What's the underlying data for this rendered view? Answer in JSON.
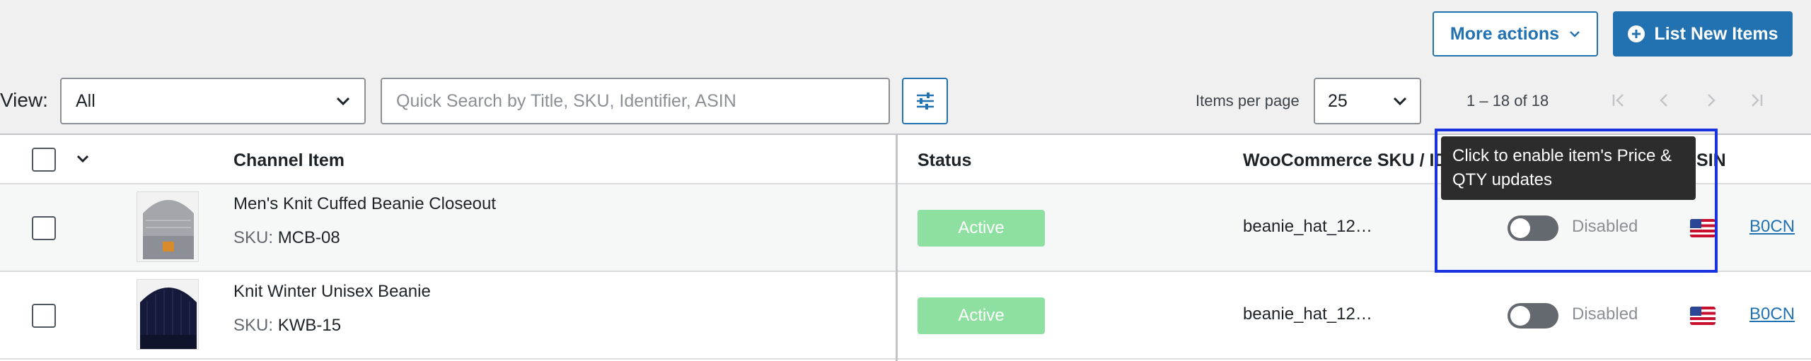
{
  "toolbar": {
    "more_actions_label": "More actions",
    "list_new_items_label": "List New Items",
    "view_label": "View:",
    "view_selected": "All",
    "search_placeholder": "Quick Search by Title, SKU, Identifier, ASIN",
    "items_per_page_label": "Items per page",
    "items_per_page_selected": "25",
    "range_text": "1 – 18 of 18"
  },
  "table": {
    "headers": {
      "channel_item": "Channel Item",
      "status": "Status",
      "woo_sku": "WooCommerce SKU / ID",
      "asin": "ASIN"
    },
    "rows": [
      {
        "title": "Men's Knit Cuffed Beanie Closeout",
        "sku_label": "SKU:",
        "sku": "MCB-08",
        "status": "Active",
        "woo_sku": "beanie_hat_12…",
        "toggle_label": "Disabled",
        "asin": "B0CN"
      },
      {
        "title": "Knit Winter Unisex Beanie",
        "sku_label": "SKU:",
        "sku": "KWB-15",
        "status": "Active",
        "woo_sku": "beanie_hat_12…",
        "toggle_label": "Disabled",
        "asin": "B0CN"
      }
    ]
  },
  "tooltip": {
    "text": "Click to enable item's Price & QTY updates"
  },
  "colors": {
    "primary": "#2271b1",
    "active_badge": "#8ee0a0",
    "highlight": "#1a33e0",
    "tooltip_bg": "#2c2c2c"
  },
  "icons": {
    "more_actions": "chevron-down-icon",
    "list_new_items": "plus-circle-icon",
    "filter": "sliders-icon",
    "pager": [
      "first-page-icon",
      "prev-page-icon",
      "next-page-icon",
      "last-page-icon"
    ],
    "flag": "us-flag-icon"
  }
}
